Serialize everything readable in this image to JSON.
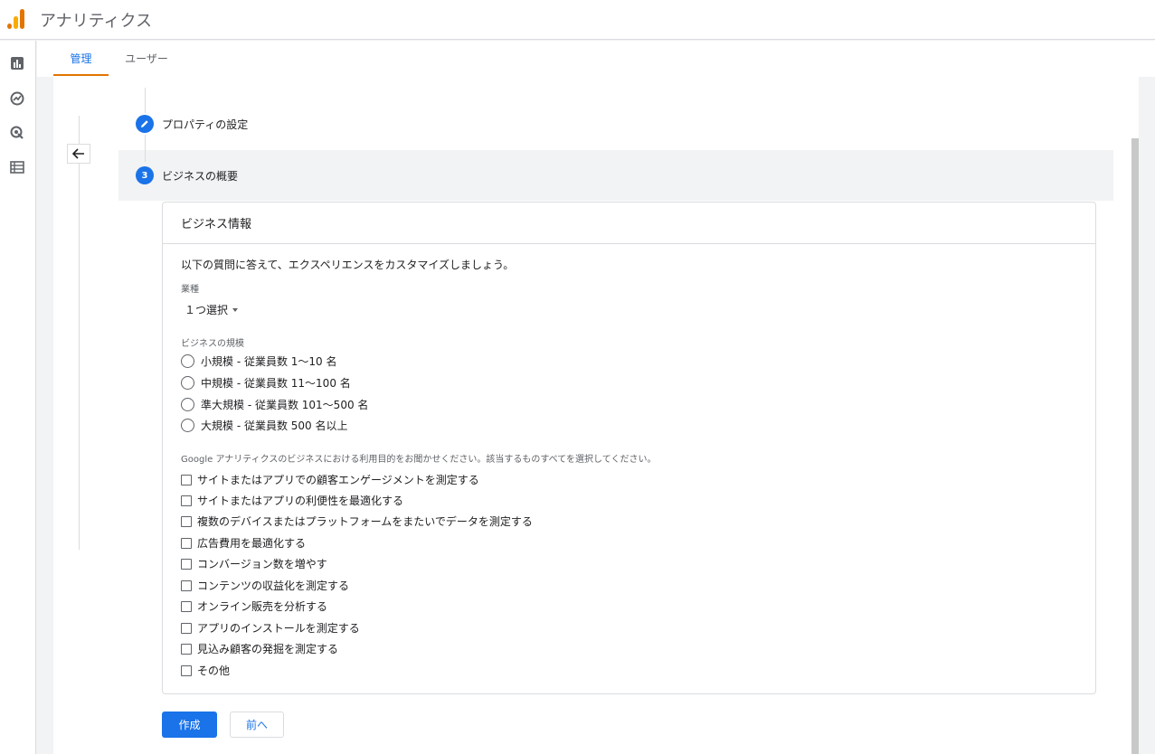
{
  "app": {
    "title": "アナリティクス"
  },
  "rail": {
    "icons": [
      "reports-icon",
      "explore-icon",
      "advertising-icon",
      "configure-icon"
    ]
  },
  "tabs": [
    {
      "label": "管理",
      "active": true
    },
    {
      "label": "ユーザー",
      "active": false
    }
  ],
  "steps": [
    {
      "label": "プロパティの設定",
      "state": "done"
    },
    {
      "number": "3",
      "label": "ビジネスの概要",
      "state": "active"
    }
  ],
  "card": {
    "title": "ビジネス情報",
    "intro": "以下の質問に答えて、エクスペリエンスをカスタマイズしましょう。",
    "industry": {
      "label": "業種",
      "value": "１つ選択"
    },
    "size": {
      "label": "ビジネスの規模",
      "options": [
        "小規模 - 従業員数 1～10 名",
        "中規模 - 従業員数 11～100 名",
        "準大規模 - 従業員数 101～500 名",
        "大規模 - 従業員数 500 名以上"
      ]
    },
    "purpose": {
      "label": "Google アナリティクスのビジネスにおける利用目的をお聞かせください。該当するものすべてを選択してください。",
      "options": [
        "サイトまたはアプリでの顧客エンゲージメントを測定する",
        "サイトまたはアプリの利便性を最適化する",
        "複数のデバイスまたはプラットフォームをまたいでデータを測定する",
        "広告費用を最適化する",
        "コンバージョン数を増やす",
        "コンテンツの収益化を測定する",
        "オンライン販売を分析する",
        "アプリのインストールを測定する",
        "見込み顧客の発掘を測定する",
        "その他"
      ]
    }
  },
  "buttons": {
    "create": "作成",
    "back": "前へ"
  },
  "colors": {
    "accent": "#1a73e8",
    "tab_indicator": "#e37400"
  }
}
